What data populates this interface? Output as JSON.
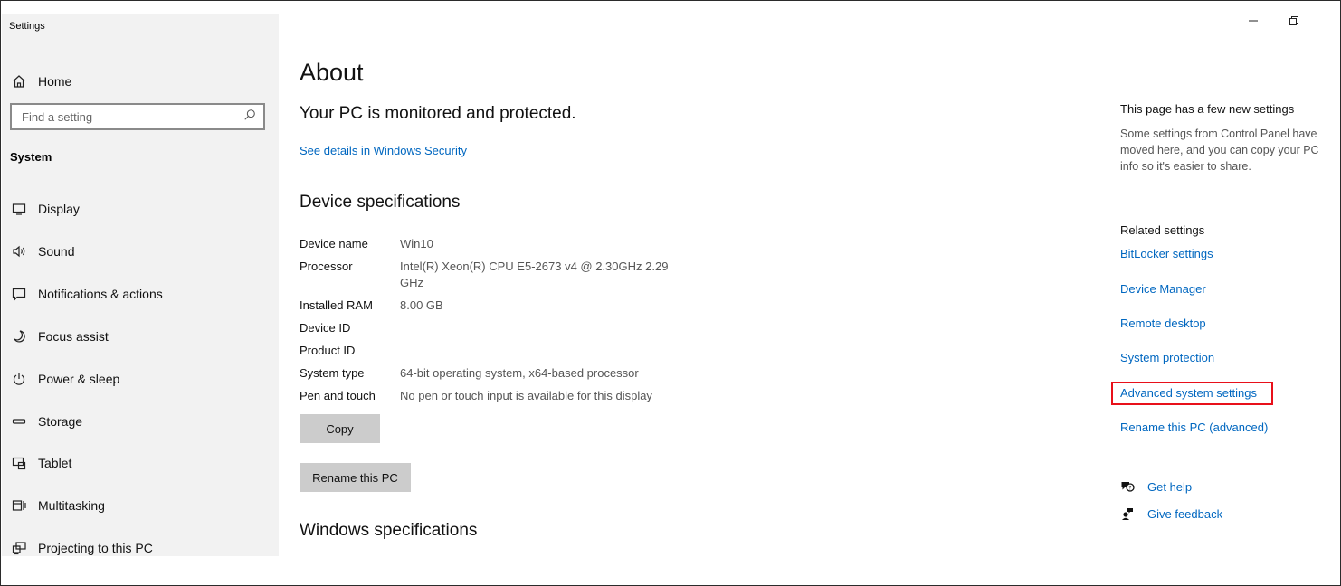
{
  "window": {
    "app_title": "Settings",
    "controls": {
      "minimize": "minimize-icon",
      "maximize": "maximize-icon"
    }
  },
  "sidebar": {
    "home": {
      "label": "Home",
      "icon": "home-icon"
    },
    "search": {
      "placeholder": "Find a setting",
      "icon": "search-icon"
    },
    "section": "System",
    "items": [
      {
        "label": "Display",
        "icon": "display-icon"
      },
      {
        "label": "Sound",
        "icon": "sound-icon"
      },
      {
        "label": "Notifications & actions",
        "icon": "notifications-icon"
      },
      {
        "label": "Focus assist",
        "icon": "moon-icon"
      },
      {
        "label": "Power & sleep",
        "icon": "power-icon"
      },
      {
        "label": "Storage",
        "icon": "storage-icon"
      },
      {
        "label": "Tablet",
        "icon": "tablet-icon"
      },
      {
        "label": "Multitasking",
        "icon": "multitasking-icon"
      },
      {
        "label": "Projecting to this PC",
        "icon": "projecting-icon"
      }
    ]
  },
  "main": {
    "title": "About",
    "status": "Your PC is monitored and protected.",
    "security_link": "See details in Windows Security",
    "device_heading": "Device specifications",
    "specs": [
      {
        "key": "Device name",
        "value": "Win10"
      },
      {
        "key": "Processor",
        "value": "Intel(R) Xeon(R) CPU E5-2673 v4 @ 2.30GHz   2.29 GHz"
      },
      {
        "key": "Installed RAM",
        "value": "8.00 GB"
      },
      {
        "key": "Device ID",
        "value": ""
      },
      {
        "key": "Product ID",
        "value": ""
      },
      {
        "key": "System type",
        "value": "64-bit operating system, x64-based processor"
      },
      {
        "key": "Pen and touch",
        "value": "No pen or touch input is available for this display"
      }
    ],
    "copy_button": "Copy",
    "rename_button": "Rename this PC",
    "windows_heading": "Windows specifications"
  },
  "right_panel": {
    "new_settings_title": "This page has a few new settings",
    "new_settings_desc": "Some settings from Control Panel have moved here, and you can copy your PC info so it's easier to share.",
    "related_title": "Related settings",
    "related_links": [
      "BitLocker settings",
      "Device Manager",
      "Remote desktop",
      "System protection",
      "Advanced system settings",
      "Rename this PC (advanced)"
    ],
    "help": {
      "label": "Get help",
      "icon": "help-icon"
    },
    "feedback": {
      "label": "Give feedback",
      "icon": "feedback-icon"
    }
  },
  "colors": {
    "link": "#0067c0",
    "sidebar_bg": "#f2f2f2",
    "button_bg": "#cccccc",
    "highlight": "#e8101a"
  }
}
